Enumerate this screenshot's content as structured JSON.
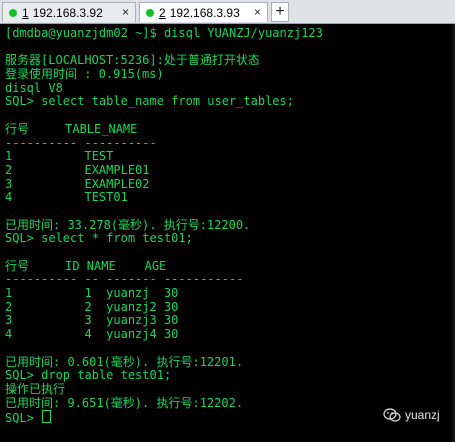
{
  "tabs": [
    {
      "number": "1",
      "label": "192.168.3.92",
      "close": "×"
    },
    {
      "number": "2",
      "label": "192.168.3.93",
      "close": "×"
    }
  ],
  "new_tab": "+",
  "terminal": {
    "lines": [
      "[dmdba@yuanzjdm02 ~]$ disql YUANZJ/yuanzj123",
      "",
      "服务器[LOCALHOST:5236]:处于普通打开状态",
      "登录使用时间 : 0.915(ms)",
      "disql V8",
      "SQL> select table_name from user_tables;",
      "",
      "行号     TABLE_NAME",
      "---------- ----------",
      "1          TEST",
      "2          EXAMPLE01",
      "3          EXAMPLE02",
      "4          TEST01",
      "",
      "已用时间: 33.278(毫秒). 执行号:12200.",
      "SQL> select * from test01;",
      "",
      "行号     ID NAME    AGE",
      "---------- -- ------- -----------",
      "1          1  yuanzj  30",
      "2          2  yuanzj2 30",
      "3          3  yuanzj3 30",
      "4          4  yuanzj4 30",
      "",
      "已用时间: 0.601(毫秒). 执行号:12201.",
      "SQL> drop table test01;",
      "操作已执行",
      "已用时间: 9.651(毫秒). 执行号:12202.",
      "SQL> "
    ]
  },
  "watermark": {
    "label": "yuanzj",
    "icon": "wechat-icon"
  },
  "colors": {
    "terminal_text": "#1bd65a",
    "terminal_bg": "#000000",
    "tab_dot": "#17c22c"
  }
}
